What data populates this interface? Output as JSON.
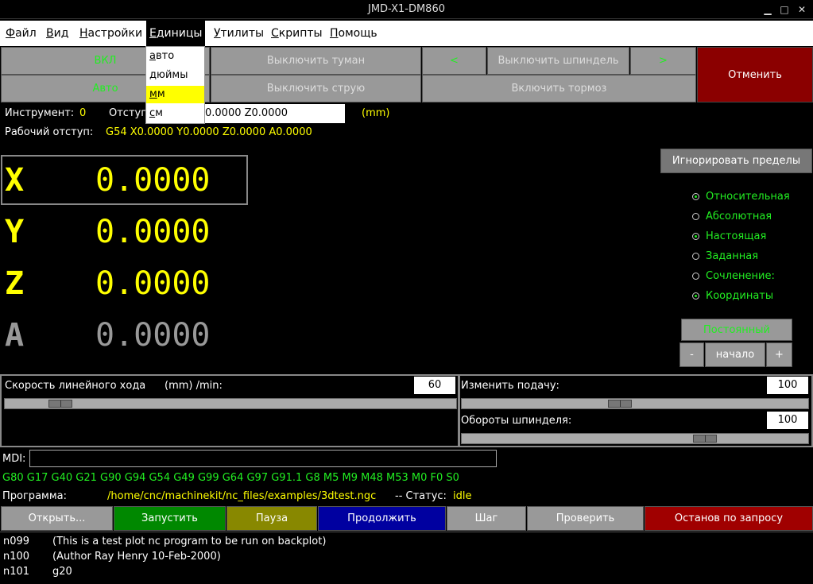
{
  "window": {
    "title": "JMD-X1-DM860"
  },
  "menu": {
    "file": {
      "u": "Ф",
      "rest": "айл"
    },
    "view": {
      "u": "В",
      "rest": "ид"
    },
    "settings": {
      "u": "Н",
      "rest": "астройки"
    },
    "units": {
      "u": "Е",
      "rest": "диницы"
    },
    "utils": {
      "u": "У",
      "rest": "тилиты"
    },
    "scripts": {
      "u": "С",
      "rest": "крипты"
    },
    "help": {
      "u": "П",
      "rest": "омощь"
    }
  },
  "units_menu": {
    "items": [
      {
        "u": "а",
        "rest": "вто"
      },
      {
        "u": "д",
        "rest": "юймы"
      },
      {
        "u": "м",
        "rest": "м"
      },
      {
        "u": "с",
        "rest": "м"
      }
    ]
  },
  "controls": {
    "on": "ВКЛ",
    "auto": "Авто",
    "mist_off": "Выключить туман",
    "flood_off": "Выключить струю",
    "spindle_left": "<",
    "spindle_off": "Выключить шпиндель",
    "spindle_right": ">",
    "brake_on": "Включить тормоз",
    "cancel": "Отменить"
  },
  "status": {
    "tool_label": "Инструмент:",
    "tool_value": "0",
    "offset_label": "Отступ",
    "offset_value": "0.0000 Z0.0000",
    "units": "(mm)",
    "work_offset_label": "Рабочий отступ:",
    "work_offset_value": "G54 X0.0000 Y0.0000 Z0.0000 A0.0000"
  },
  "dro": {
    "axes": [
      {
        "name": "X",
        "value": "0.0000",
        "color": "#ffff00"
      },
      {
        "name": "Y",
        "value": "0.0000",
        "color": "#ffff00"
      },
      {
        "name": "Z",
        "value": "0.0000",
        "color": "#ffff00"
      },
      {
        "name": "A",
        "value": "0.0000",
        "color": "#999999"
      }
    ]
  },
  "right_panel": {
    "ignore_limits": "Игнорировать пределы",
    "radios": [
      {
        "label": "Относительная",
        "selected": true
      },
      {
        "label": "Абсолютная",
        "selected": false
      },
      {
        "label": "Настоящая",
        "selected": true
      },
      {
        "label": "Заданная",
        "selected": false
      },
      {
        "label": "Сочленение:",
        "selected": false
      },
      {
        "label": "Координаты",
        "selected": true
      }
    ],
    "jog_mode": "Постоянный",
    "minus": "-",
    "home": "начало",
    "plus": "+"
  },
  "sliders": {
    "jog_speed_label": "Скорость линейного хода",
    "jog_speed_units": "(mm) /min:",
    "jog_speed_value": "60",
    "feed_override_label": "Изменить подачу:",
    "feed_override_value": "100",
    "spindle_override_label": "Обороты шпинделя:",
    "spindle_override_value": "100"
  },
  "mdi": {
    "label": "MDI:",
    "value": "",
    "gcodes": "G80 G17 G40 G21 G90 G94 G54 G49 G99 G64 G97 G91.1 G8 M5 M9 M48 M53 M0 F0 S0"
  },
  "program": {
    "label": "Программа:",
    "path": "/home/cnc/machinekit/nc_files/examples/3dtest.ngc",
    "status_label": "-- Статус:",
    "status_value": "idle"
  },
  "program_buttons": {
    "open": "Открыть...",
    "run": "Запустить",
    "pause": "Пауза",
    "resume": "Продолжить",
    "step": "Шаг",
    "verify": "Проверить",
    "optional_stop": "Останов по запросу"
  },
  "code": {
    "lines": [
      {
        "n": "n099",
        "text": "(This is a test plot nc program to be run on backplot)"
      },
      {
        "n": "n100",
        "text": "(Author Ray Henry 10-Feb-2000)"
      },
      {
        "n": "n101",
        "text": "g20"
      }
    ]
  },
  "colors": {
    "accent_green": "#22ee22",
    "value_yellow": "#ffff00",
    "cancel_red": "#8b0000",
    "run_green": "#008800",
    "pause_olive": "#888800",
    "resume_blue": "#0000a0",
    "stop_red": "#a00000"
  }
}
